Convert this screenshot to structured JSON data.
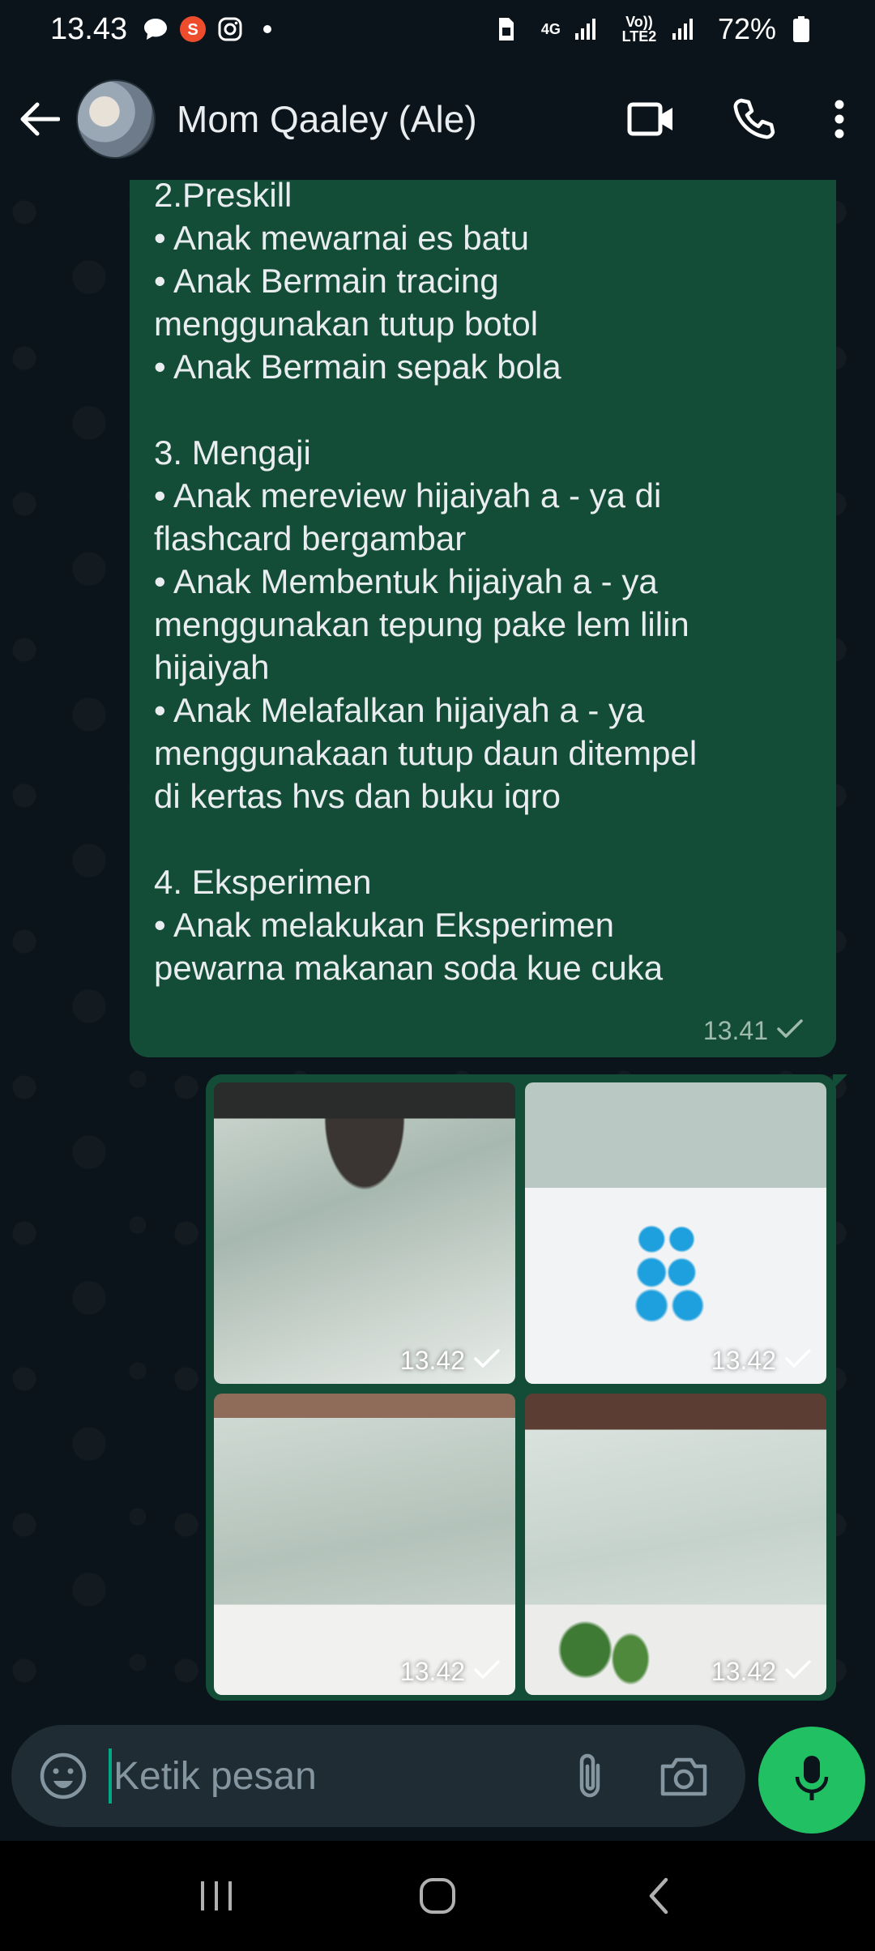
{
  "status_bar": {
    "time": "13.43",
    "network_type": "4G",
    "volte_label": "Vo)) LTE2",
    "battery": "72%",
    "icons": [
      "chat-bubble-icon",
      "shopee-icon",
      "instagram-icon",
      "dot-icon",
      "sim-icon",
      "signal-icon",
      "signal-icon",
      "battery-icon"
    ]
  },
  "header": {
    "contact_name": "Mom Qaaley (Ale)",
    "icons": [
      "back-arrow-icon",
      "avatar",
      "video-call-icon",
      "phone-icon",
      "more-vert-icon"
    ]
  },
  "message": {
    "lines": [
      "2.Preskill",
      "   •   Anak mewarnai es batu",
      "   •    Anak Bermain tracing",
      "         menggunakan tutup botol",
      "   •   Anak Bermain sepak bola",
      "",
      "     3. Mengaji",
      "   •   Anak mereview hijaiyah a - ya di",
      "         flashcard bergambar",
      "   •   Anak  Membentuk hijaiyah a - ya",
      "         menggunakan tepung pake lem lilin",
      "         hijaiyah",
      "   •   Anak  Melafalkan hijaiyah a - ya",
      "         menggunakaan tutup daun ditempel",
      "         di kertas hvs dan buku iqro",
      "",
      "     4. Eksperimen",
      "   •   Anak melakukan  Eksperimen",
      "         pewarna makanan soda kue cuka"
    ],
    "time": "13.41",
    "status_icon": "single-check-icon"
  },
  "media": {
    "items": [
      {
        "time": "13.42"
      },
      {
        "time": "13.42"
      },
      {
        "time": "13.42"
      },
      {
        "time": "13.42"
      }
    ]
  },
  "input": {
    "placeholder": "Ketik pesan",
    "icons": [
      "emoji-icon",
      "attach-icon",
      "camera-icon",
      "mic-icon"
    ]
  },
  "nav": {
    "icons": [
      "recents-icon",
      "home-icon",
      "back-icon"
    ]
  },
  "colors": {
    "background": "#0b141a",
    "outgoing_bubble": "#144d37",
    "accent_green": "#21c063",
    "input_bg": "#1f2c34"
  }
}
